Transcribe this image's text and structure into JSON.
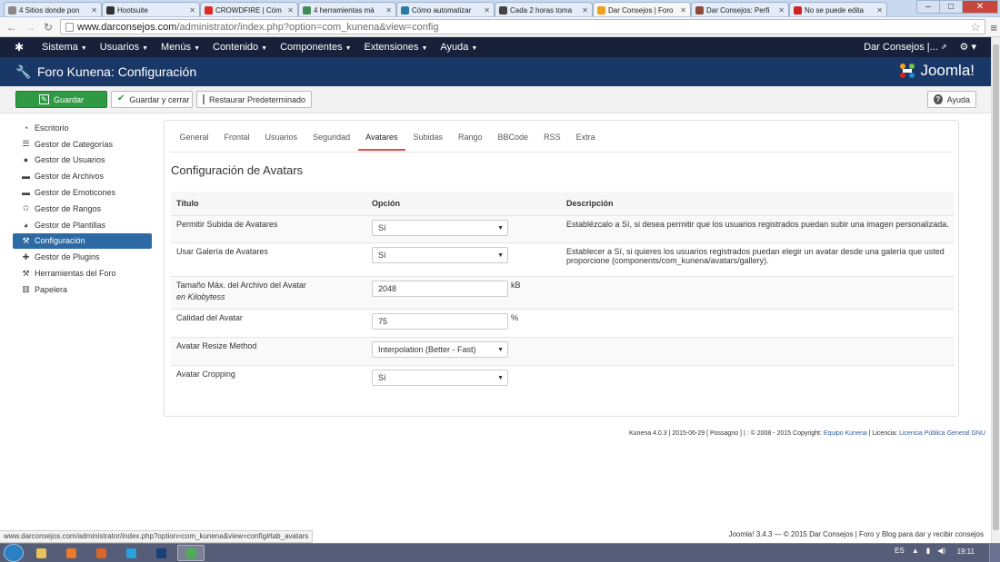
{
  "browser": {
    "tabs": [
      {
        "title": "4 Sitios donde pon",
        "favicon_color": "#8a8a8a"
      },
      {
        "title": "Hootsuite",
        "favicon_color": "#333333"
      },
      {
        "title": "CROWDFIRE | Cóm",
        "favicon_color": "#e02a20"
      },
      {
        "title": "4 herramientas má",
        "favicon_color": "#3f8d5a"
      },
      {
        "title": "Cómo automatizar",
        "favicon_color": "#2c7aa8"
      },
      {
        "title": "Cada 2 horas toma",
        "favicon_color": "#444444"
      },
      {
        "title": "Dar Consejos | Foro",
        "favicon_color": "#f0a020",
        "active": true
      },
      {
        "title": "Dar Consejos: Perfi",
        "favicon_color": "#8a4b3a"
      },
      {
        "title": "No se puede edita",
        "favicon_color": "#d02020"
      }
    ],
    "url_host": "www.darconsejos.com",
    "url_path": "/administrator/index.php?option=com_kunena&view=config",
    "status_url": "www.darconsejos.com/administrator/index.php?option=com_kunena&view=config#tab_avatars"
  },
  "admin_nav": {
    "menu": [
      "Sistema",
      "Usuarios",
      "Menús",
      "Contenido",
      "Componentes",
      "Extensiones",
      "Ayuda"
    ],
    "site_label": "Dar Consejos |..."
  },
  "header": {
    "title": "Foro Kunena: Configuración",
    "brand": "Joomla!"
  },
  "toolbar": {
    "save": "Guardar",
    "save_close": "Guardar y cerrar",
    "restore": "Restaurar Predeterminado",
    "help": "Ayuda"
  },
  "sidebar": [
    {
      "label": "Escritorio",
      "icon": "dashboard-icon"
    },
    {
      "label": "Gestor de Categorías",
      "icon": "list-icon"
    },
    {
      "label": "Gestor de Usuarios",
      "icon": "user-icon"
    },
    {
      "label": "Gestor de Archivos",
      "icon": "folder-icon"
    },
    {
      "label": "Gestor de Emoticones",
      "icon": "folder-icon"
    },
    {
      "label": "Gestor de Rangos",
      "icon": "star-icon"
    },
    {
      "label": "Gestor de Plantillas",
      "icon": "palette-icon"
    },
    {
      "label": "Configuración",
      "icon": "wrench-icon",
      "active": true
    },
    {
      "label": "Gestor de Plugins",
      "icon": "puzzle-icon"
    },
    {
      "label": "Herramientas del Foro",
      "icon": "wrench-icon"
    },
    {
      "label": "Papelera",
      "icon": "trash-icon"
    }
  ],
  "config_tabs": [
    "General",
    "Frontal",
    "Usuarios",
    "Seguridad",
    "Avatares",
    "Subidas",
    "Rango",
    "BBCode",
    "RSS",
    "Extra"
  ],
  "active_tab": "Avatares",
  "section_title": "Configuración de Avatars",
  "table": {
    "headers": [
      "Título",
      "Opción",
      "Descripción"
    ],
    "rows": [
      {
        "title": "Permitir Subida de Avatares",
        "control": "select",
        "value": "Sí",
        "description": "Establézcalo a Sí, si desea permitir que los usuarios registrados puedan subir una imagen personalizada."
      },
      {
        "title": "Usar Galería de Avatares",
        "control": "select",
        "value": "Sí",
        "description": "Establecer a Sí, si quieres los usuarios registrados puedan elegir un avatar desde una galería que usted proporcione (components/com_kunena/avatars/gallery)."
      },
      {
        "title": "Tamaño Máx. del Archivo del Avatar",
        "subtitle": "en Kilobytess",
        "control": "input",
        "value": "2048",
        "unit": "kB",
        "description": ""
      },
      {
        "title": "Calidad del Avatar",
        "control": "input",
        "value": "75",
        "unit": "%",
        "description": ""
      },
      {
        "title": "Avatar Resize Method",
        "control": "select",
        "value": "Interpolation (Better - Fast)",
        "description": ""
      },
      {
        "title": "Avatar Cropping",
        "control": "select",
        "value": "Sí",
        "description": ""
      }
    ]
  },
  "kunena_footer": {
    "text": "Kunena 4.0.3 | 2015-06-29 [ Possagno ] | : © 2008 - 2015 Copyright:",
    "team_link": "Equipo Kunena",
    "license_label": "| Licencia:",
    "license_link": "Licencia Pública General GNU"
  },
  "joomla_footer": "Joomla! 3.4.3  —  © 2015 Dar Consejos | Foro y Blog para dar y recibir consejos",
  "taskbar": {
    "language": "ES",
    "time": "19:11",
    "apps": [
      {
        "name": "explorer",
        "color": "#e8c25a"
      },
      {
        "name": "media-player",
        "color": "#e87a2a"
      },
      {
        "name": "firefox",
        "color": "#d9662b"
      },
      {
        "name": "skype",
        "color": "#2aa0dc"
      },
      {
        "name": "photoshop",
        "color": "#1a3f7a"
      },
      {
        "name": "chrome",
        "color": "#4caf50"
      }
    ]
  },
  "colors": {
    "nav_bg": "#17213a",
    "title_bg": "#1a3867",
    "save_green": "#2f9a44",
    "active_blue": "#2d6aa3",
    "tab_accent": "#d8534a"
  }
}
